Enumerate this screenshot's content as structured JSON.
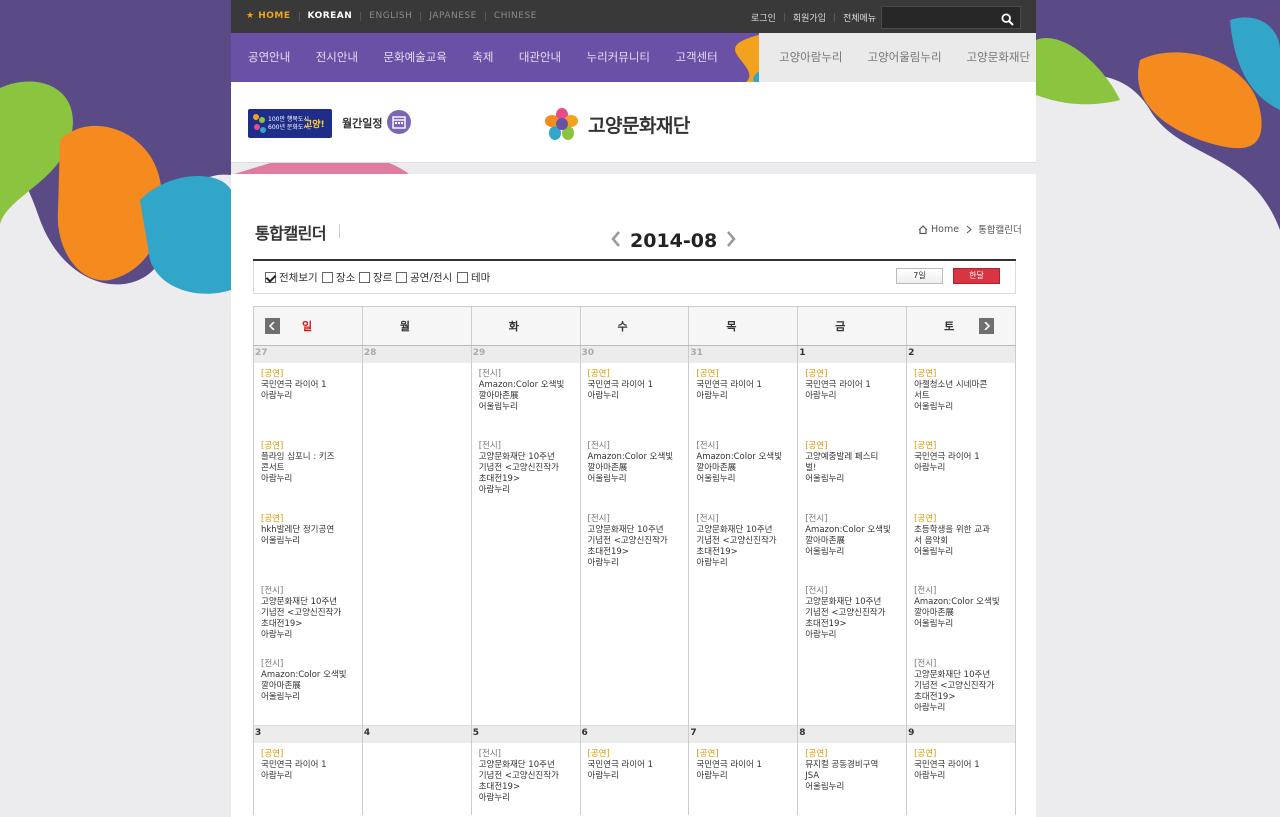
{
  "topbar": {
    "home": "HOME",
    "languages": [
      "KOREAN",
      "ENGLISH",
      "JAPANESE",
      "CHINESE"
    ],
    "util": [
      "로그인",
      "회원가입",
      "전체메뉴"
    ],
    "search_placeholder": ""
  },
  "gnb": {
    "main": [
      "공연안내",
      "전시안내",
      "문화예술교육",
      "축제",
      "대관안내",
      "누리커뮤니티",
      "고객센터"
    ],
    "venues": [
      "고양아람누리",
      "고양어울림누리",
      "고양문화재단"
    ]
  },
  "header": {
    "badge_line1": "100만 행복도시,",
    "badge_line2": "600년 문화도시,",
    "badge_brand": "고양!",
    "monthly": "월간일정",
    "logo": "고양문화재단"
  },
  "page": {
    "title": "통합캘린더",
    "month": "2014-08",
    "crumb_home": "Home",
    "crumb_current": "통합캘린더"
  },
  "filter": {
    "items": [
      {
        "label": "전체보기",
        "checked": true
      },
      {
        "label": "장소",
        "checked": false
      },
      {
        "label": "장르",
        "checked": false
      },
      {
        "label": "공연/전시",
        "checked": false
      },
      {
        "label": "테마",
        "checked": false
      }
    ],
    "week": "7일",
    "month": "한달"
  },
  "calendar": {
    "days": [
      "일",
      "월",
      "화",
      "수",
      "목",
      "금",
      "토"
    ],
    "weeks": [
      {
        "dates": [
          {
            "n": "27",
            "dim": true
          },
          {
            "n": "28",
            "dim": true
          },
          {
            "n": "29",
            "dim": true
          },
          {
            "n": "30",
            "dim": true
          },
          {
            "n": "31",
            "dim": true
          },
          {
            "n": "1",
            "dim": false
          },
          {
            "n": "2",
            "dim": false
          }
        ],
        "events": [
          [
            {
              "k": "[공연]",
              "t": [
                "국민연극 라이어 1",
                "아람누리"
              ]
            },
            {
              "k": "[공연]",
              "t": [
                "플라잉 심포니 : 키즈",
                "콘서트",
                "아람누리"
              ]
            },
            {
              "k": "[공연]",
              "t": [
                "hkh발레단 정기공연",
                "어울림누리"
              ]
            },
            {
              "k": "[전시]",
              "t": [
                "고양문화재단 10주년",
                "기념전 <고양신진작가",
                "초대전19>",
                "아람누리"
              ]
            },
            {
              "k": "[전시]",
              "t": [
                "Amazon:Color 오색빛",
                "깔아마존展",
                "어울림누리"
              ]
            }
          ],
          [],
          [
            {
              "k": "[전시]",
              "t": [
                "Amazon:Color 오색빛",
                "깔아마존展",
                "어울림누리"
              ]
            },
            {
              "k": "[전시]",
              "t": [
                "고양문화재단 10주년",
                "기념전 <고양신진작가",
                "초대전19>",
                "아람누리"
              ]
            }
          ],
          [
            {
              "k": "[공연]",
              "t": [
                "국민연극 라이어 1",
                "아람누리"
              ]
            },
            {
              "k": "[전시]",
              "t": [
                "Amazon:Color 오색빛",
                "깔아마존展",
                "어울림누리"
              ]
            },
            {
              "k": "[전시]",
              "t": [
                "고양문화재단 10주년",
                "기념전 <고양신진작가",
                "초대전19>",
                "아람누리"
              ]
            }
          ],
          [
            {
              "k": "[공연]",
              "t": [
                "국민연극 라이어 1",
                "아람누리"
              ]
            },
            {
              "k": "[전시]",
              "t": [
                "Amazon:Color 오색빛",
                "깔아마존展",
                "어울림누리"
              ]
            },
            {
              "k": "[전시]",
              "t": [
                "고양문화재단 10주년",
                "기념전 <고양신진작가",
                "초대전19>",
                "아람누리"
              ]
            }
          ],
          [
            {
              "k": "[공연]",
              "t": [
                "국민연극 라이어 1",
                "아람누리"
              ]
            },
            {
              "k": "[공연]",
              "t": [
                "고양예중발레 페스티",
                "벌!",
                "어울림누리"
              ]
            },
            {
              "k": "[전시]",
              "t": [
                "Amazon:Color 오색빛",
                "깔아마존展",
                "어울림누리"
              ]
            },
            {
              "k": "[전시]",
              "t": [
                "고양문화재단 10주년",
                "기념전 <고양신진작가",
                "초대전19>",
                "아람누리"
              ]
            }
          ],
          [
            {
              "k": "[공연]",
              "t": [
                "아젤청소년 시네마콘",
                "서트",
                "어울림누리"
              ]
            },
            {
              "k": "[공연]",
              "t": [
                "국민연극 라이어 1",
                "아람누리"
              ]
            },
            {
              "k": "[공연]",
              "t": [
                "초등학생을 위한 교과",
                "서 음악회",
                "어울림누리"
              ]
            },
            {
              "k": "[전시]",
              "t": [
                "Amazon:Color 오색빛",
                "깔아마존展",
                "어울림누리"
              ]
            },
            {
              "k": "[전시]",
              "t": [
                "고양문화재단 10주년",
                "기념전 <고양신진작가",
                "초대전19>",
                "아람누리"
              ]
            }
          ]
        ]
      },
      {
        "dates": [
          {
            "n": "3",
            "dim": false
          },
          {
            "n": "4",
            "dim": false
          },
          {
            "n": "5",
            "dim": false
          },
          {
            "n": "6",
            "dim": false
          },
          {
            "n": "7",
            "dim": false
          },
          {
            "n": "8",
            "dim": false
          },
          {
            "n": "9",
            "dim": false
          }
        ],
        "events": [
          [
            {
              "k": "[공연]",
              "t": [
                "국민연극 라이어 1",
                "아람누리"
              ]
            }
          ],
          [],
          [
            {
              "k": "[전시]",
              "t": [
                "고양문화재단 10주년",
                "기념전 <고양신진작가",
                "초대전19>",
                "아람누리"
              ]
            }
          ],
          [
            {
              "k": "[공연]",
              "t": [
                "국민연극 라이어 1",
                "아람누리"
              ]
            }
          ],
          [
            {
              "k": "[공연]",
              "t": [
                "국민연극 라이어 1",
                "아람누리"
              ]
            }
          ],
          [
            {
              "k": "[공연]",
              "t": [
                "뮤지컬 공동경비구역",
                "JSA",
                "어울림누리"
              ]
            }
          ],
          [
            {
              "k": "[공연]",
              "t": [
                "국민연극 라이어 1",
                "아람누리"
              ]
            }
          ]
        ]
      }
    ]
  },
  "colors": {
    "topbar": "#393939",
    "gnb": "#6a51a6",
    "highlight": "#f2a21c",
    "event_perf": "#d99a00",
    "month_btn": "#d7353f"
  }
}
